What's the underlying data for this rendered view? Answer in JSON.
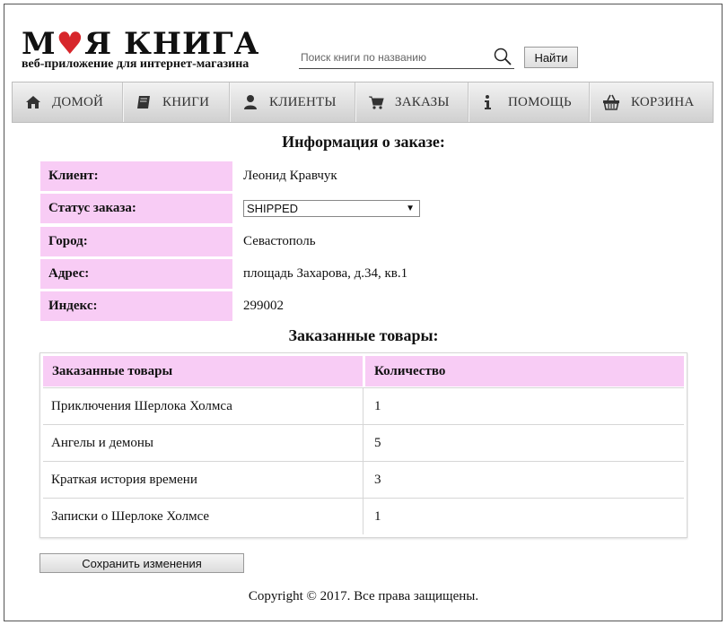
{
  "brand": {
    "title_part1": "М",
    "title_heart": "♥",
    "title_part2": "Я КНИГА",
    "subtitle": "веб-приложение для интернет-магазина",
    "heart_color": "#d7262b"
  },
  "search": {
    "placeholder": "Поиск книги по названию",
    "value": "",
    "button_label": "Найти"
  },
  "nav": {
    "items": [
      {
        "label": "ДОМОЙ",
        "icon": "home-icon"
      },
      {
        "label": "КНИГИ",
        "icon": "book-icon"
      },
      {
        "label": "КЛИЕНТЫ",
        "icon": "user-icon"
      },
      {
        "label": "ЗАКАЗЫ",
        "icon": "cart-icon"
      },
      {
        "label": "ПОМОЩЬ",
        "icon": "info-icon"
      },
      {
        "label": "КОРЗИНА",
        "icon": "basket-icon"
      }
    ]
  },
  "order": {
    "heading": "Информация о заказе:",
    "client_label": "Клиент:",
    "client_value": "Леонид Кравчук",
    "status_label": "Статус заказа:",
    "status_value": "SHIPPED",
    "city_label": "Город:",
    "city_value": "Севастополь",
    "address_label": "Адрес:",
    "address_value": "площадь Захарова, д.34, кв.1",
    "index_label": "Индекс:",
    "index_value": "299002"
  },
  "items": {
    "heading": "Заказанные товары:",
    "col_title": "Заказанные товары",
    "col_qty": "Количество",
    "rows": [
      {
        "title": "Приключения Шерлока Холмса",
        "qty": "1"
      },
      {
        "title": "Ангелы и демоны",
        "qty": "5"
      },
      {
        "title": "Краткая история времени",
        "qty": "3"
      },
      {
        "title": "Записки о Шерлоке Холмсе",
        "qty": "1"
      }
    ]
  },
  "actions": {
    "save_label": "Сохранить изменения"
  },
  "footer": {
    "text": "Copyright © 2017. Все права защищены."
  },
  "colors": {
    "label_bg": "#f8ccf5",
    "nav_bg": "#dcdcdc"
  }
}
